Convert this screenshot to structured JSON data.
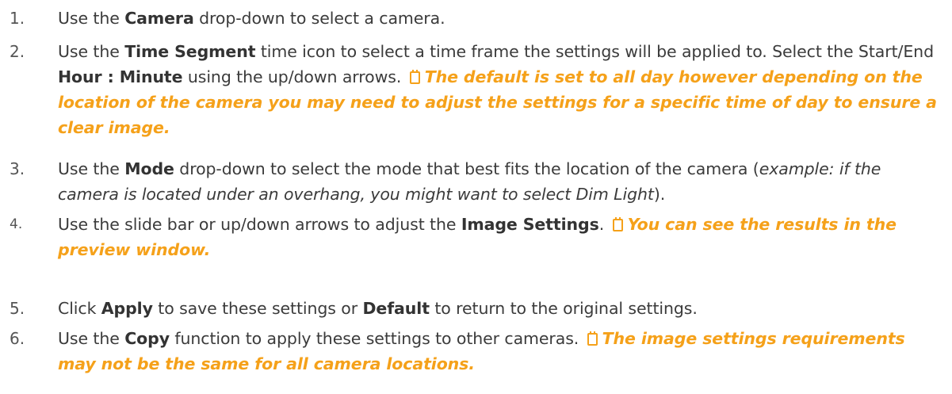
{
  "steps": [
    {
      "number": "1.",
      "t1": "Use the ",
      "b1": "Camera",
      "t2": " drop-down to select a camera."
    },
    {
      "number": "2.",
      "t1": "Use the ",
      "b1": "Time Segment",
      "t2": " time icon to select a time frame the settings will be applied to. Select the Start/End ",
      "b2": "Hour : Minute",
      "t3": " using the up/down arrows. ",
      "note": "The default is set to all day however depending on the location of the camera you may need to adjust the settings for a specific time of day to ensure a clear image."
    },
    {
      "number": "3.",
      "t1": "Use the ",
      "b1": "Mode",
      "t2": " drop-down to select the mode that best fits the location of the camera (",
      "example": "example: if the camera is located under an overhang, you might want to select Dim Light",
      "t3": ")."
    },
    {
      "number": "4.",
      "t1": "Use the slide bar or up/down arrows to adjust the ",
      "b1": "Image Settings",
      "t2": ". ",
      "note": "You can see the results in the preview window."
    },
    {
      "number": "5.",
      "t1": "Click ",
      "b1": "Apply",
      "t2": " to save these settings or ",
      "b2": "Default",
      "t3": " to return to the original settings."
    },
    {
      "number": "6.",
      "t1": "Use the ",
      "b1": "Copy",
      "t2": " function to apply these settings to other cameras. ",
      "note": "The image settings requirements may not be the same for all camera locations."
    }
  ],
  "icons": {
    "note": "note-icon"
  },
  "colors": {
    "note": "#f5a11a",
    "text": "#3b3b3b"
  }
}
